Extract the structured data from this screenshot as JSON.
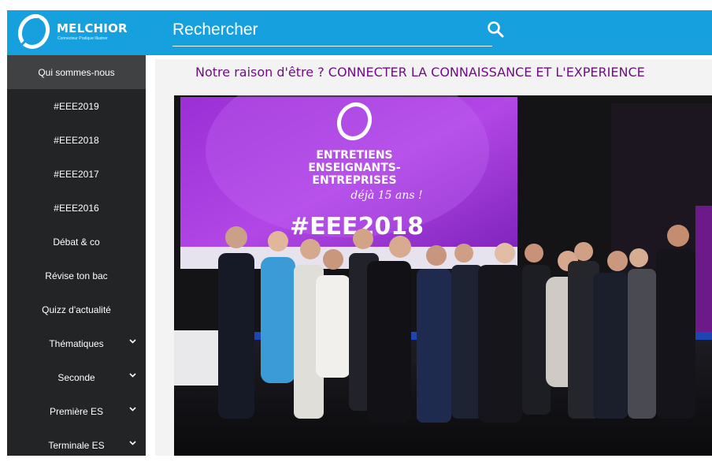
{
  "brand": {
    "name": "MELCHIOR",
    "tagline": "Connecteur Pratique Illustrer"
  },
  "search": {
    "placeholder": "Rechercher",
    "icon": "search-icon"
  },
  "sidebar": {
    "items": [
      {
        "label": "Qui sommes-nous",
        "active": true
      },
      {
        "label": "#EEE2019"
      },
      {
        "label": "#EEE2018"
      },
      {
        "label": "#EEE2017"
      },
      {
        "label": "#EEE2016"
      },
      {
        "label": "Débat & co"
      },
      {
        "label": "Révise ton bac"
      },
      {
        "label": "Quizz d'actualité"
      },
      {
        "label": "Thématiques",
        "dropdown": true
      },
      {
        "label": "Seconde",
        "dropdown": true
      },
      {
        "label": "Première ES",
        "dropdown": true
      },
      {
        "label": "Terminale ES",
        "dropdown": true
      }
    ]
  },
  "main": {
    "headline": "Notre raison d'être ? CONNECTER LA CONNAISSANCE ET L'EXPERIENCE",
    "photo": {
      "screen_line1": "ENTRETIENS",
      "screen_line2": "ENSEIGNANTS-",
      "screen_line3": "ENTREPRISES",
      "screen_script": "déjà 15 ans !",
      "screen_hashtag": "#EEE2018"
    }
  },
  "colors": {
    "header": "#16a0de",
    "sidebar": "#222426",
    "sidebar_active": "#404143",
    "headline": "#6f0f83"
  }
}
